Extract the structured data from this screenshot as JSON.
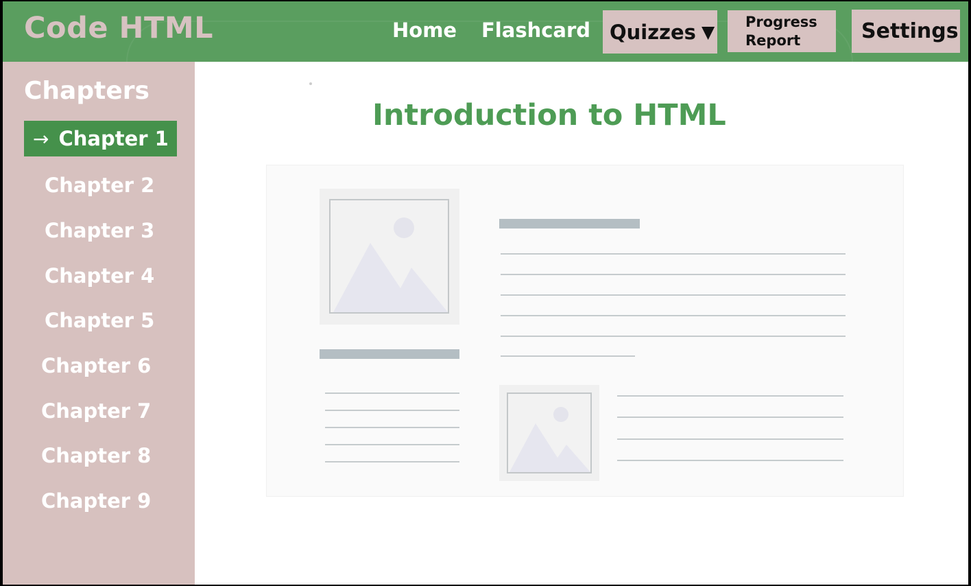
{
  "app": {
    "title": "Code HTML"
  },
  "nav": {
    "home": "Home",
    "flashcard": "Flashcard",
    "quizzes": "Quizzes",
    "quizzes_caret": "▼",
    "progress_line1": "Progress",
    "progress_line2": "Report",
    "settings": "Settings"
  },
  "sidebar": {
    "title": "Chapters",
    "active_arrow": "→",
    "items": [
      {
        "label": "Chapter 1"
      },
      {
        "label": "Chapter 2"
      },
      {
        "label": "Chapter 3"
      },
      {
        "label": "Chapter 4"
      },
      {
        "label": "Chapter 5"
      },
      {
        "label": "Chapter 6"
      },
      {
        "label": "Chapter 7"
      },
      {
        "label": "Chapter 8"
      },
      {
        "label": "Chapter 9"
      }
    ]
  },
  "main": {
    "title": "Introduction to HTML"
  },
  "colors": {
    "header": "#5a9e5f",
    "sidebar": "#d7c1bf",
    "active_item": "#45914b",
    "title": "#4e9c55",
    "button": "#d7c2c1"
  }
}
